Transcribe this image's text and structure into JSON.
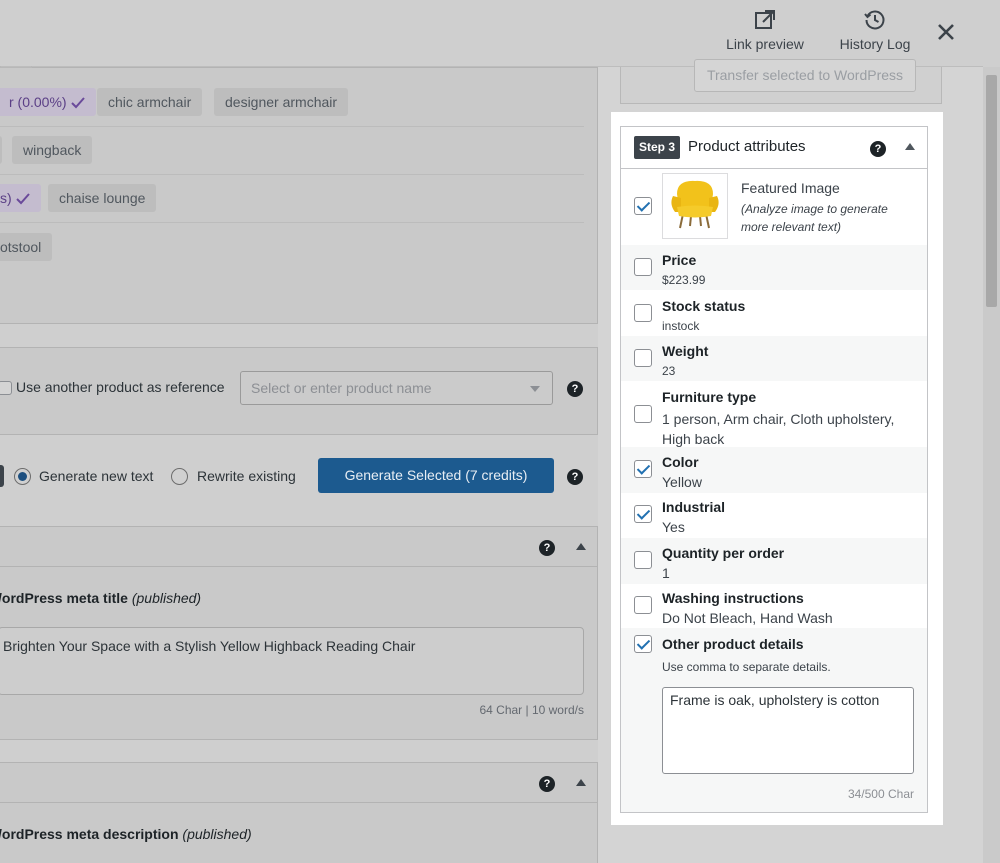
{
  "topbar": {
    "link_preview": "Link preview",
    "history_log": "History Log"
  },
  "keywords": {
    "row1": [
      {
        "label": "r (0.00%)",
        "selected": true
      },
      {
        "label": "chic armchair",
        "selected": false
      },
      {
        "label": "designer armchair",
        "selected": false
      }
    ],
    "row2": [
      {
        "label": "wingback",
        "selected": false
      }
    ],
    "row3": [
      {
        "label": "s)",
        "selected": true
      },
      {
        "label": "chaise lounge",
        "selected": false
      }
    ],
    "row4": [
      {
        "label": "otstool",
        "selected": false
      }
    ]
  },
  "reference": {
    "label": "Use another product as reference",
    "placeholder": "Select or enter product name"
  },
  "generate": {
    "option_new": "Generate new text",
    "option_rewrite": "Rewrite existing",
    "button": "Generate Selected (7 credits)"
  },
  "meta_title_section": {
    "label": "/ordPress meta title",
    "status": "(published)",
    "value": "Brighten Your Space with a Stylish Yellow Highback Reading Chair",
    "count": "64 Char | 10 word/s"
  },
  "meta_desc_section": {
    "label": "/ordPress meta description",
    "status": "(published)"
  },
  "transfer": {
    "button": "Transfer selected to WordPress"
  },
  "attributes": {
    "step": "Step 3",
    "title": "Product attributes",
    "featured": {
      "title": "Featured Image",
      "note": "(Analyze image to generate more relevant text)",
      "checked": true
    },
    "items": [
      {
        "label": "Price",
        "value": "$223.99",
        "checked": false
      },
      {
        "label": "Stock status",
        "value": "instock",
        "checked": false
      },
      {
        "label": "Weight",
        "value": "23",
        "checked": false
      },
      {
        "label": "Furniture type",
        "value": "1 person, Arm chair, Cloth upholstery, High back",
        "checked": false
      },
      {
        "label": "Color",
        "value": "Yellow",
        "checked": true
      },
      {
        "label": "Industrial",
        "value": "Yes",
        "checked": true
      },
      {
        "label": "Quantity per order",
        "value": "1",
        "checked": false
      },
      {
        "label": "Washing instructions",
        "value": "Do Not Bleach, Hand Wash",
        "checked": false
      }
    ],
    "other": {
      "label": "Other product details",
      "hint": "Use comma to separate details.",
      "value": "Frame is oak, upholstery is cotton",
      "count": "34/500 Char",
      "checked": true
    }
  },
  "colors": {
    "accent": "#2271b1",
    "button": "#1c5a8f",
    "keyword_selected": "#5b3f86"
  }
}
